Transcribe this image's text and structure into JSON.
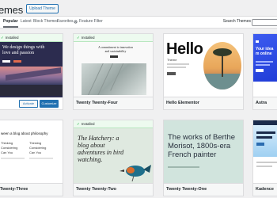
{
  "header": {
    "title": "emes",
    "upload_label": "Upload Theme"
  },
  "filters": {
    "tabs": [
      "Popular",
      "Latest",
      "Block Themes",
      "Favorites"
    ],
    "feature_filter": "Feature Filter",
    "search_label": "Search Themes"
  },
  "installed_label": "Installed",
  "themes": [
    {
      "name": "",
      "installed": true,
      "headline": "We design things with love and passion",
      "buttons": [
        "Activate",
        "Customize"
      ]
    },
    {
      "name": "Twenty Twenty-Four",
      "installed": true,
      "headline": "A commitment to innovation and sustainability"
    },
    {
      "name": "Hello Elementor",
      "installed": false,
      "headline": "Hello",
      "sub": "Theme"
    },
    {
      "name": "Astra",
      "installed": false,
      "headline": "Your idea m online"
    },
    {
      "name": "Twenty-Three",
      "installed": false,
      "headline": "ween a blog about philosophy",
      "lines": [
        "Thinking",
        "Considering",
        "Can You"
      ]
    },
    {
      "name": "Twenty Twenty-Two",
      "installed": true,
      "headline": "The Hatchery: a blog about adventures in bird watching."
    },
    {
      "name": "Twenty Twenty-One",
      "installed": false,
      "headline": "The works of Berthe Morisot, 1800s-era French painter"
    },
    {
      "name": "Kadence",
      "installed": false,
      "headline": ""
    }
  ],
  "colors": {
    "accent": "#2271b1",
    "installed_bg": "#edfaef",
    "installed_check": "#00a32a"
  }
}
